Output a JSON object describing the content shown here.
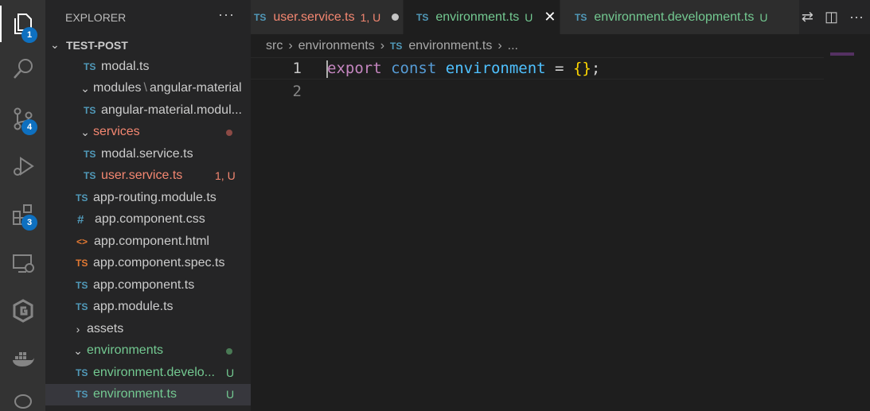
{
  "activity_bar": {
    "badges": {
      "explorer": "1",
      "source_control": "4",
      "extensions": "3"
    }
  },
  "sidebar": {
    "header": "EXPLORER",
    "more": "···",
    "section": "TEST-POST",
    "rows": [
      {
        "icon_text": "TS",
        "label": "modal.ts"
      },
      {
        "label": "modules",
        "label_b": "angular-material"
      },
      {
        "icon_text": "TS",
        "label": "angular-material.modul..."
      },
      {
        "label": "services"
      },
      {
        "icon_text": "TS",
        "label": "modal.service.ts"
      },
      {
        "icon_text": "TS",
        "label": "user.service.ts",
        "status": "1, U"
      },
      {
        "icon_text": "TS",
        "label": "app-routing.module.ts"
      },
      {
        "icon_text": "#",
        "label": "app.component.css"
      },
      {
        "icon_text": "<>",
        "label": "app.component.html"
      },
      {
        "icon_text": "TS",
        "label": "app.component.spec.ts"
      },
      {
        "icon_text": "TS",
        "label": "app.component.ts"
      },
      {
        "icon_text": "TS",
        "label": "app.module.ts"
      },
      {
        "label": "assets"
      },
      {
        "label": "environments"
      },
      {
        "icon_text": "TS",
        "label": "environment.develo...",
        "status": "U"
      },
      {
        "icon_text": "TS",
        "label": "environment.ts",
        "status": "U"
      }
    ]
  },
  "tabs": [
    {
      "icon_text": "TS",
      "label": "user.service.ts",
      "status": "1, U"
    },
    {
      "icon_text": "TS",
      "label": "environment.ts",
      "status": "U",
      "close": "✕"
    },
    {
      "icon_text": "TS",
      "label": "environment.development.ts",
      "status": "U"
    }
  ],
  "breadcrumb": {
    "parts": [
      "src",
      "environments"
    ],
    "file_icon": "TS",
    "file": "environment.ts",
    "tail": "..."
  },
  "editor": {
    "lines": [
      {
        "number": "1",
        "tokens": [
          "export",
          "const",
          "environment",
          "=",
          "{}",
          ";"
        ]
      },
      {
        "number": "2"
      }
    ]
  },
  "colors": {
    "modified_red": "#f48771",
    "untracked_green": "#73c991",
    "ts_blue": "#519aba",
    "accent_badge": "#0e70c0"
  }
}
